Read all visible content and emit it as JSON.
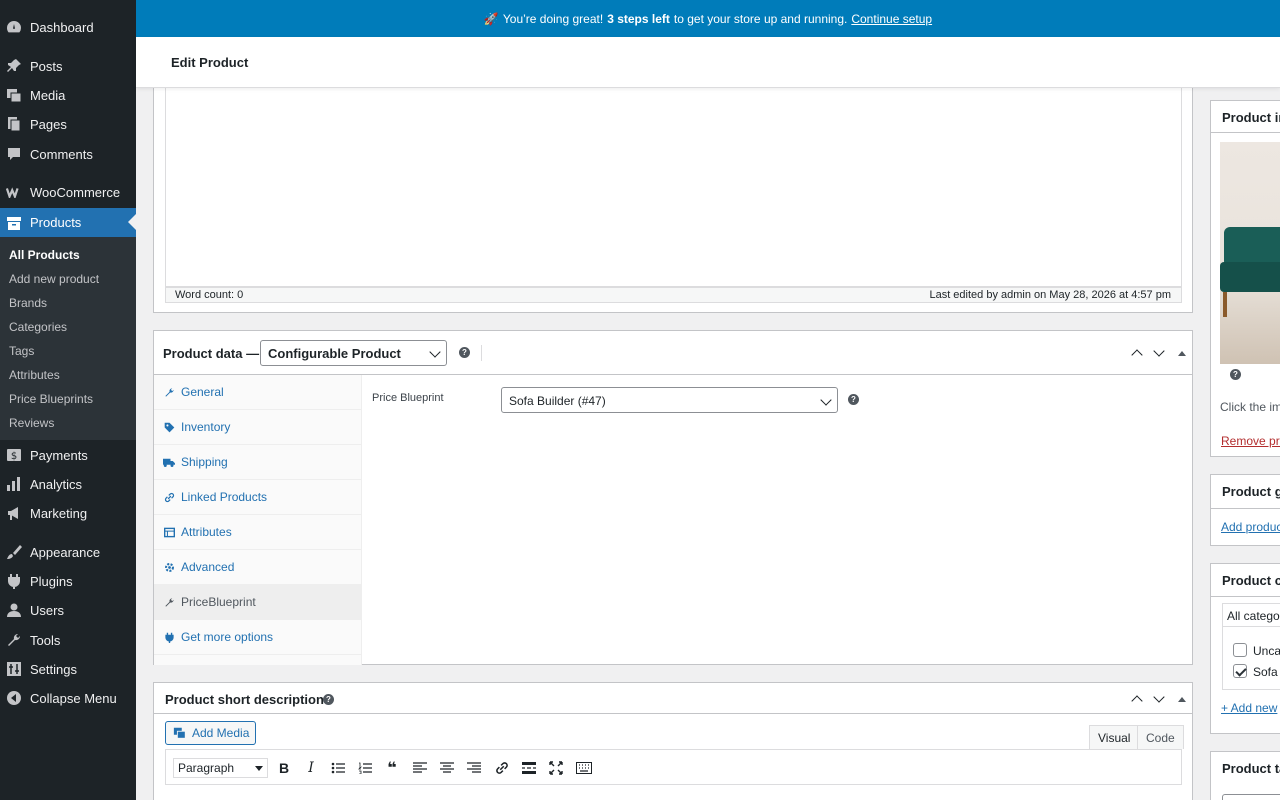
{
  "sidebar": {
    "items": [
      {
        "label": "Dashboard",
        "icon": "dashboard-icon"
      },
      {
        "label": "Posts",
        "icon": "pin-icon"
      },
      {
        "label": "Media",
        "icon": "media-icon"
      },
      {
        "label": "Pages",
        "icon": "pages-icon"
      },
      {
        "label": "Comments",
        "icon": "comment-icon"
      },
      {
        "label": "WooCommerce",
        "icon": "woocommerce-icon"
      },
      {
        "label": "Products",
        "icon": "archive-icon"
      },
      {
        "label": "Payments",
        "icon": "dollar-icon"
      },
      {
        "label": "Analytics",
        "icon": "chart-bar-icon"
      },
      {
        "label": "Marketing",
        "icon": "megaphone-icon"
      },
      {
        "label": "Appearance",
        "icon": "brush-icon"
      },
      {
        "label": "Plugins",
        "icon": "plug-icon"
      },
      {
        "label": "Users",
        "icon": "user-icon"
      },
      {
        "label": "Tools",
        "icon": "wrench-icon"
      },
      {
        "label": "Settings",
        "icon": "settings-icon"
      },
      {
        "label": "Collapse Menu",
        "icon": "collapse-icon"
      }
    ],
    "submenu": [
      "All Products",
      "Add new product",
      "Brands",
      "Categories",
      "Tags",
      "Attributes",
      "Price Blueprints",
      "Reviews"
    ]
  },
  "banner": {
    "emoji": "🚀",
    "text_before": "You’re doing great!",
    "bold": "3 steps left",
    "text_after": "to get your store up and running.",
    "link": "Continue setup"
  },
  "header": {
    "title": "Edit Product"
  },
  "editor": {
    "word_count": "Word count: 0",
    "last_edited": "Last edited by admin on May 28, 2026 at 4:57 pm"
  },
  "product_data": {
    "title": "Product data —",
    "type_value": "Configurable Product",
    "tabs": [
      {
        "label": "General",
        "icon": "wrench-icon"
      },
      {
        "label": "Inventory",
        "icon": "tag-icon"
      },
      {
        "label": "Shipping",
        "icon": "truck-icon"
      },
      {
        "label": "Linked Products",
        "icon": "link-icon"
      },
      {
        "label": "Attributes",
        "icon": "table-icon"
      },
      {
        "label": "Advanced",
        "icon": "gear-icon"
      },
      {
        "label": "PriceBlueprint",
        "icon": "wrench-icon"
      },
      {
        "label": "Get more options",
        "icon": "plugin-icon"
      }
    ],
    "active_tab": "PriceBlueprint",
    "field_label": "Price Blueprint",
    "field_value": "Sofa Builder (#47)"
  },
  "short_description": {
    "title": "Product short description",
    "add_media": "Add Media",
    "tab_visual": "Visual",
    "tab_code": "Code",
    "format": "Paragraph"
  },
  "side": {
    "image_title": "Product in",
    "image_hint": "Click the im",
    "remove_link": "Remove pro",
    "gallery_title": "Product ga",
    "gallery_link": "Add produc",
    "cat_title": "Product ca",
    "cat_tab": "All categor",
    "categories": [
      {
        "label": "Unca",
        "checked": false
      },
      {
        "label": "Sofa",
        "checked": true
      }
    ],
    "add_new_cat": "+ Add new",
    "tags_title": "Product ta"
  }
}
